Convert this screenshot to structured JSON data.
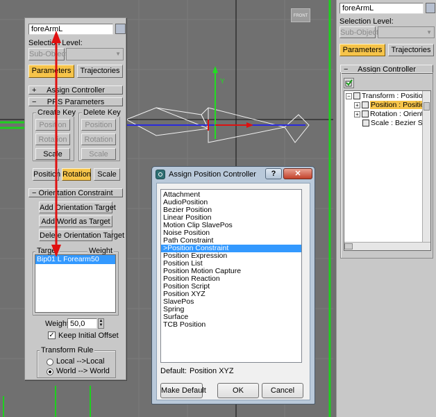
{
  "viewport": {
    "label": "FRONT",
    "colors": {
      "background": "#707070",
      "grid": "#7c7c7c",
      "x_axis": "#2a2add",
      "y_axis": "#22dd22",
      "red": "#dd1111"
    }
  },
  "float_panel": {
    "object_name": "foreArmL",
    "selection_level": "Selection Level:",
    "sub_object": "Sub-Object",
    "tabs": {
      "parameters": "Parameters",
      "trajectories": "Trajectories"
    },
    "assign_controller": "Assign Controller",
    "prs_parameters": "PRS Parameters",
    "create_key": {
      "label": "Create Key",
      "position": "Position",
      "rotation": "Rotation",
      "scale": "Scale"
    },
    "delete_key": {
      "label": "Delete Key",
      "position": "Position",
      "rotation": "Rotation",
      "scale": "Scale"
    },
    "mode_buttons": {
      "position": "Position",
      "rotation": "Rotation",
      "scale": "Scale"
    },
    "orientation_constraint": "Orientation Constraint",
    "add_orientation_target": "Add Orientation Target",
    "add_world_as_target": "Add World as Target",
    "delete_orientation_target": "Delete Orientation Target",
    "target_header": "Target",
    "weight_header": "Weight",
    "targets": [
      {
        "name": "Bip01 L Forearm",
        "weight": "50"
      }
    ],
    "weight_label": "Weight",
    "weight_value": "50,0",
    "keep_initial_offset": "Keep Initial Offset",
    "transform_rule": {
      "label": "Transform Rule",
      "local": "Local -->Local",
      "world": "World --> World"
    }
  },
  "command_panel": {
    "object_name": "foreArmL",
    "selection_level": "Selection Level:",
    "sub_object": "Sub-Object",
    "tabs": {
      "parameters": "Parameters",
      "trajectories": "Trajectories"
    },
    "assign_controller": "Assign Controller",
    "tree": {
      "root": "Transform : Position/",
      "children": [
        {
          "label": "Position : Position",
          "selected": true
        },
        {
          "label": "Rotation : Orientat"
        },
        {
          "label": "Scale : Bezier Scal"
        }
      ]
    }
  },
  "dialog": {
    "title": "Assign Position Controller",
    "help": "?",
    "close": "✕",
    "controllers": [
      "Attachment",
      "AudioPosition",
      "Bezier Position",
      "Linear Position",
      "Motion Clip SlavePos",
      "Noise Position",
      "Path Constraint",
      ">Position Constraint",
      "Position Expression",
      "Position List",
      "Position Motion Capture",
      "Position Reaction",
      "Position Script",
      "Position XYZ",
      "SlavePos",
      "Spring",
      "Surface",
      "TCB Position"
    ],
    "selected_index": 7,
    "default_label": "Default:",
    "default_value": "Position XYZ",
    "make_default": "Make Default",
    "ok": "OK",
    "cancel": "Cancel",
    "colors": {
      "selection": "#3399ff",
      "title_bg": "#b9c9da"
    }
  },
  "annotation": {
    "color": "#e01010"
  }
}
